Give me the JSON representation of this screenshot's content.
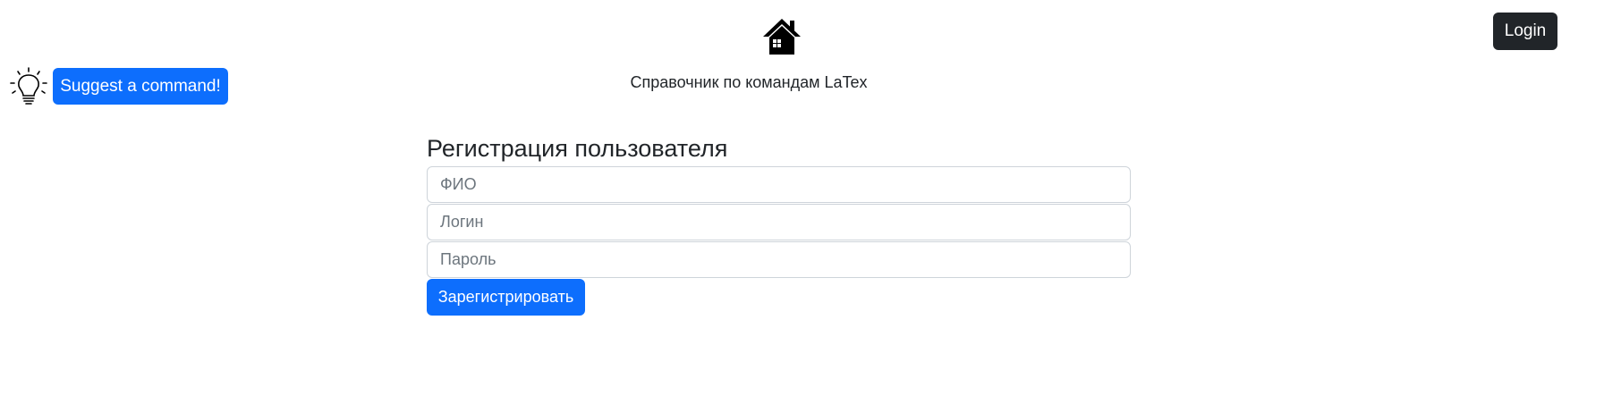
{
  "header": {
    "home_icon": "home-icon",
    "subtitle": "Справочник по командам LaTex",
    "login_label": "Login"
  },
  "suggest": {
    "icon": "lightbulb-icon",
    "label": "Suggest a command!"
  },
  "form": {
    "title": "Регистрация пользователя",
    "fields": [
      {
        "name": "full-name",
        "value": "",
        "placeholder": "ФИО"
      },
      {
        "name": "login",
        "value": "",
        "placeholder": "Логин"
      },
      {
        "name": "password",
        "value": "",
        "placeholder": "Пароль"
      }
    ],
    "submit_label": "Зарегистрировать"
  },
  "colors": {
    "primary": "#0d6efd",
    "dark": "#212529",
    "border": "#ced4da",
    "placeholder": "#6c757d"
  }
}
